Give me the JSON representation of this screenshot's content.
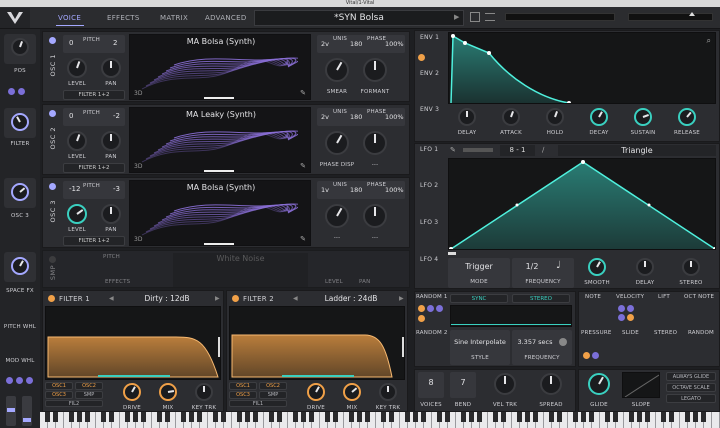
{
  "window": {
    "title": "Vital/1-Vital"
  },
  "nav": {
    "tabs": [
      "VOICE",
      "EFFECTS",
      "MATRIX",
      "ADVANCED"
    ],
    "active": "VOICE"
  },
  "preset": {
    "name": "*SYN Bolsa"
  },
  "sidebar": {
    "pos": "POS",
    "filter": "FILTER",
    "osc3": "OSC 3",
    "spacefx": "SPACE FX",
    "pitchwhl": "PITCH WHL",
    "modwhl": "MOD WHL"
  },
  "oscillators": [
    {
      "label": "OSC 1",
      "pitch": "PITCH",
      "transpose": "0",
      "tune": "2",
      "wavetable": "MA Bolsa (Synth)",
      "unison_label": "UNISON",
      "voices": "2v",
      "detune": "2%",
      "phase_label": "PHASE",
      "phase": "180",
      "phase_rand": "100%",
      "level": "LEVEL",
      "pan": "PAN",
      "dest": "FILTER 1+2",
      "knob1": "SMEAR",
      "knob2": "FORMANT",
      "dim": "3D"
    },
    {
      "label": "OSC 2",
      "pitch": "PITCH",
      "transpose": "0",
      "tune": "-2",
      "wavetable": "MA Leaky (Synth)",
      "unison_label": "UNISON",
      "voices": "2v",
      "detune": "2%",
      "phase_label": "PHASE",
      "phase": "180",
      "phase_rand": "100%",
      "level": "LEVEL",
      "pan": "PAN",
      "dest": "FILTER 1+2",
      "knob1": "PHASE DISP",
      "knob2": "---",
      "dim": "3D"
    },
    {
      "label": "OSC 3",
      "pitch": "PITCH",
      "transpose": "-12",
      "tune": "-3",
      "wavetable": "MA Bolsa (Synth)",
      "unison_label": "UNISON",
      "voices": "1v",
      "detune": "20%",
      "phase_label": "PHASE",
      "phase": "180",
      "phase_rand": "100%",
      "level": "LEVEL",
      "pan": "PAN",
      "dest": "FILTER 1+2",
      "knob1": "---",
      "knob2": "---",
      "dim": "3D"
    }
  ],
  "smp": {
    "label": "SMP",
    "name": "White Noise",
    "pitch": "PITCH",
    "effects": "EFFECTS",
    "level": "LEVEL",
    "pan": "PAN"
  },
  "filters": [
    {
      "label": "FILTER 1",
      "type": "Dirty : 12dB",
      "routes": [
        "OSC1",
        "OSC2",
        "OSC3",
        "SMP"
      ],
      "link": "FIL2",
      "knobs": [
        "DRIVE",
        "MIX",
        "KEY TRK"
      ]
    },
    {
      "label": "FILTER 2",
      "type": "Ladder : 24dB",
      "routes": [
        "OSC1",
        "OSC2",
        "OSC3",
        "SMP"
      ],
      "link": "FIL1",
      "knobs": [
        "DRIVE",
        "MIX",
        "KEY TRK"
      ]
    }
  ],
  "env": {
    "tabs": [
      "ENV 1",
      "ENV 2",
      "ENV 3"
    ],
    "knobs": [
      "DELAY",
      "ATTACK",
      "HOLD",
      "DECAY",
      "SUSTAIN",
      "RELEASE"
    ]
  },
  "lfo": {
    "tabs": [
      "LFO 1",
      "LFO 2",
      "LFO 3",
      "LFO 4"
    ],
    "grid": "8 - 1",
    "shape": "Triangle",
    "mode_value": "Trigger",
    "mode_label": "MODE",
    "freq_value": "1/2",
    "freq_label": "FREQUENCY",
    "knobs": [
      "SMOOTH",
      "DELAY",
      "STEREO"
    ]
  },
  "random": {
    "tabs": [
      "RANDOM 1",
      "RANDOM 2"
    ],
    "sync": "SYNC",
    "stereo": "STEREO",
    "style_value": "Sine Interpolate",
    "style_label": "STYLE",
    "freq_value": "3.357 secs",
    "freq_label": "FREQUENCY"
  },
  "midi": {
    "note": "NOTE",
    "velocity": "VELOCITY",
    "lift": "LIFT",
    "octnote": "OCT NOTE",
    "pressure": "PRESSURE",
    "slide": "SLIDE",
    "stereo": "STEREO",
    "random": "RANDOM"
  },
  "voice": {
    "voices_value": "8",
    "voices_label": "VOICES",
    "bend_value": "7",
    "bend_label": "BEND",
    "veltrk": "VEL TRK",
    "spread": "SPREAD",
    "glide": "GLIDE",
    "slope": "SLOPE",
    "always_glide": "ALWAYS GLIDE",
    "octave_scale": "OCTAVE SCALE",
    "legato": "LEGATO"
  },
  "colors": {
    "accent": "#a4a8ff",
    "teal": "#3ad0c0",
    "orange": "#f0a048",
    "wave": "#8a6fd6"
  }
}
